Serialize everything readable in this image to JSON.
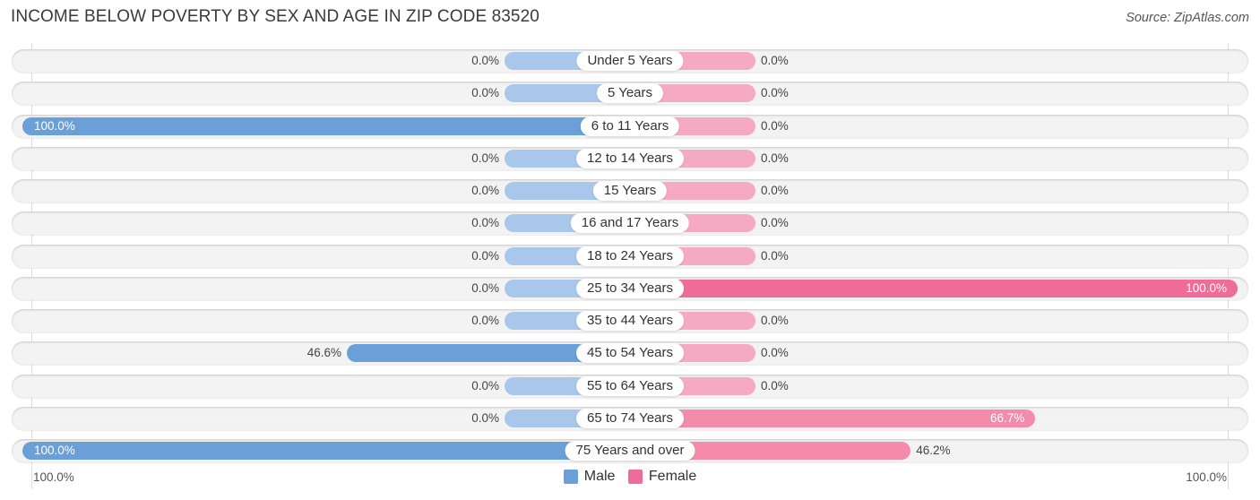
{
  "chart_data": {
    "type": "bar",
    "orientation": "horizontal-diverging",
    "title": "INCOME BELOW POVERTY BY SEX AND AGE IN ZIP CODE 83520",
    "source": "Source: ZipAtlas.com",
    "categories": [
      "Under 5 Years",
      "5 Years",
      "6 to 11 Years",
      "12 to 14 Years",
      "15 Years",
      "16 and 17 Years",
      "18 to 24 Years",
      "25 to 34 Years",
      "35 to 44 Years",
      "45 to 54 Years",
      "55 to 64 Years",
      "65 to 74 Years",
      "75 Years and over"
    ],
    "series": [
      {
        "name": "Male",
        "color": "#6a9fd8",
        "values": [
          0.0,
          0.0,
          100.0,
          0.0,
          0.0,
          0.0,
          0.0,
          0.0,
          0.0,
          46.6,
          0.0,
          0.0,
          100.0
        ],
        "labels": [
          "0.0%",
          "0.0%",
          "100.0%",
          "0.0%",
          "0.0%",
          "0.0%",
          "0.0%",
          "0.0%",
          "0.0%",
          "46.6%",
          "0.0%",
          "0.0%",
          "100.0%"
        ]
      },
      {
        "name": "Female",
        "color": "#f06c98",
        "values": [
          0.0,
          0.0,
          0.0,
          0.0,
          0.0,
          0.0,
          0.0,
          100.0,
          0.0,
          0.0,
          0.0,
          66.7,
          46.2
        ],
        "labels": [
          "0.0%",
          "0.0%",
          "0.0%",
          "0.0%",
          "0.0%",
          "0.0%",
          "0.0%",
          "100.0%",
          "0.0%",
          "0.0%",
          "0.0%",
          "66.7%",
          "46.2%"
        ]
      }
    ],
    "xlim": [
      -100,
      100
    ],
    "axis_labels": {
      "left": "100.0%",
      "right": "100.0%"
    },
    "legend": [
      "Male",
      "Female"
    ],
    "legend_position": "bottom-center",
    "grid": false
  }
}
